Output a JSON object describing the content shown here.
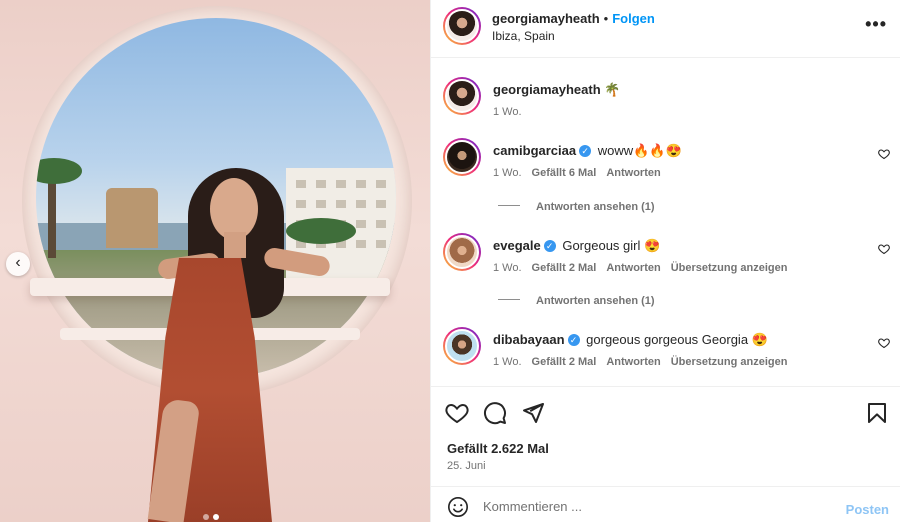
{
  "post": {
    "author": "georgiamayheath",
    "follow_label": "Folgen",
    "separator": "•",
    "location": "Ibiza, Spain",
    "more_label": "•••",
    "caption_emoji": "🌴",
    "caption_time": "1 Wo."
  },
  "carousel": {
    "prev_label": "‹",
    "dot_count": 2,
    "active_dot": 2
  },
  "comments": [
    {
      "username": "camibgarciaa",
      "verified": true,
      "text": "woww🔥🔥😍",
      "time": "1 Wo.",
      "likes": "Gefällt 6 Mal",
      "reply": "Antworten",
      "translate": "",
      "view_replies": "Antworten ansehen (1)"
    },
    {
      "username": "evegale",
      "verified": true,
      "text": "Gorgeous girl 😍",
      "time": "1 Wo.",
      "likes": "Gefällt 2 Mal",
      "reply": "Antworten",
      "translate": "Übersetzung anzeigen",
      "view_replies": "Antworten ansehen (1)"
    },
    {
      "username": "dibabayaan",
      "verified": true,
      "text": "gorgeous gorgeous Georgia 😍",
      "time": "1 Wo.",
      "likes": "Gefällt 2 Mal",
      "reply": "Antworten",
      "translate": "Übersetzung anzeigen",
      "view_replies": ""
    }
  ],
  "actions": {
    "like_count": "Gefällt 2.622 Mal",
    "date": "25. Juni",
    "icons": [
      "heart-icon",
      "comment-icon",
      "share-icon",
      "bookmark-icon"
    ]
  },
  "comment_box": {
    "placeholder": "Kommentieren ...",
    "post_label": "Posten",
    "emoji_icon": "smiley-icon"
  },
  "colors": {
    "link": "#0095f6",
    "verified": "#3797f0",
    "post_disabled": "#8ec5f5",
    "muted": "#737373"
  }
}
